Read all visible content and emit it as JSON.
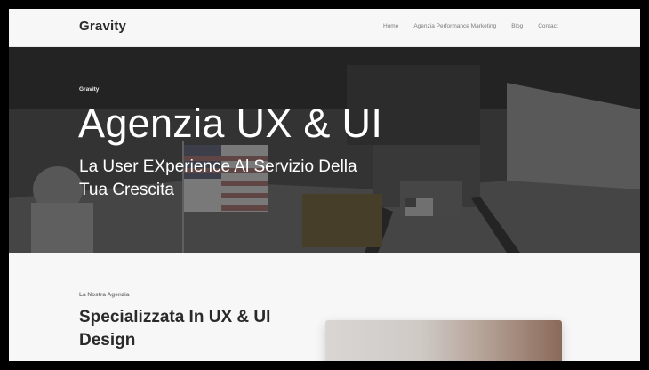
{
  "header": {
    "logo": "Gravity",
    "nav": [
      "Home",
      "Agenzia Performance Marketing",
      "Blog",
      "Contact"
    ]
  },
  "hero": {
    "kicker": "Gravity",
    "title": "Agenzia UX & UI",
    "subtitle": "La User EXperience Al Servizio Della Tua Crescita"
  },
  "about": {
    "kicker": "La Nostra Agenzia",
    "title": "Specializzata In UX & UI Design"
  },
  "colors": {
    "page_bg": "#f7f7f7",
    "text_dark": "#2a2a2a",
    "hero_text": "#ffffff"
  }
}
